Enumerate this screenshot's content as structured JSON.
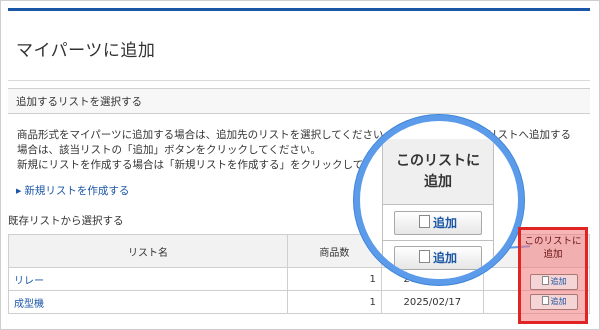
{
  "page": {
    "title": "マイパーツに追加",
    "section_title": "追加するリストを選択する",
    "description": [
      "商品形式をマイパーツに追加する場合は、追加先のリストを選択してください。",
      "場合は、該当リストの「追加」ボタンをクリックしてください。",
      "新規にリストを作成する場合は「新規リストを作成する」をクリックしてく"
    ],
    "description_tail": "既存リストへ追加する",
    "create_link": "新規リストを作成する",
    "existing_label": "既存リストから選択する"
  },
  "table": {
    "headers": {
      "name": "リスト名",
      "count": "商品数"
    },
    "rows": [
      {
        "name": "リレー",
        "count": "1",
        "date": "2025/02/17"
      },
      {
        "name": "成型機",
        "count": "1",
        "date": "2025/02/17"
      }
    ]
  },
  "callout": {
    "header_line1": "このリストに",
    "header_line2": "追加",
    "button_label": "追加"
  },
  "colors": {
    "accent": "#1a56a6",
    "highlight": "#e02424",
    "magnifier_ring": "#5b9bea"
  }
}
